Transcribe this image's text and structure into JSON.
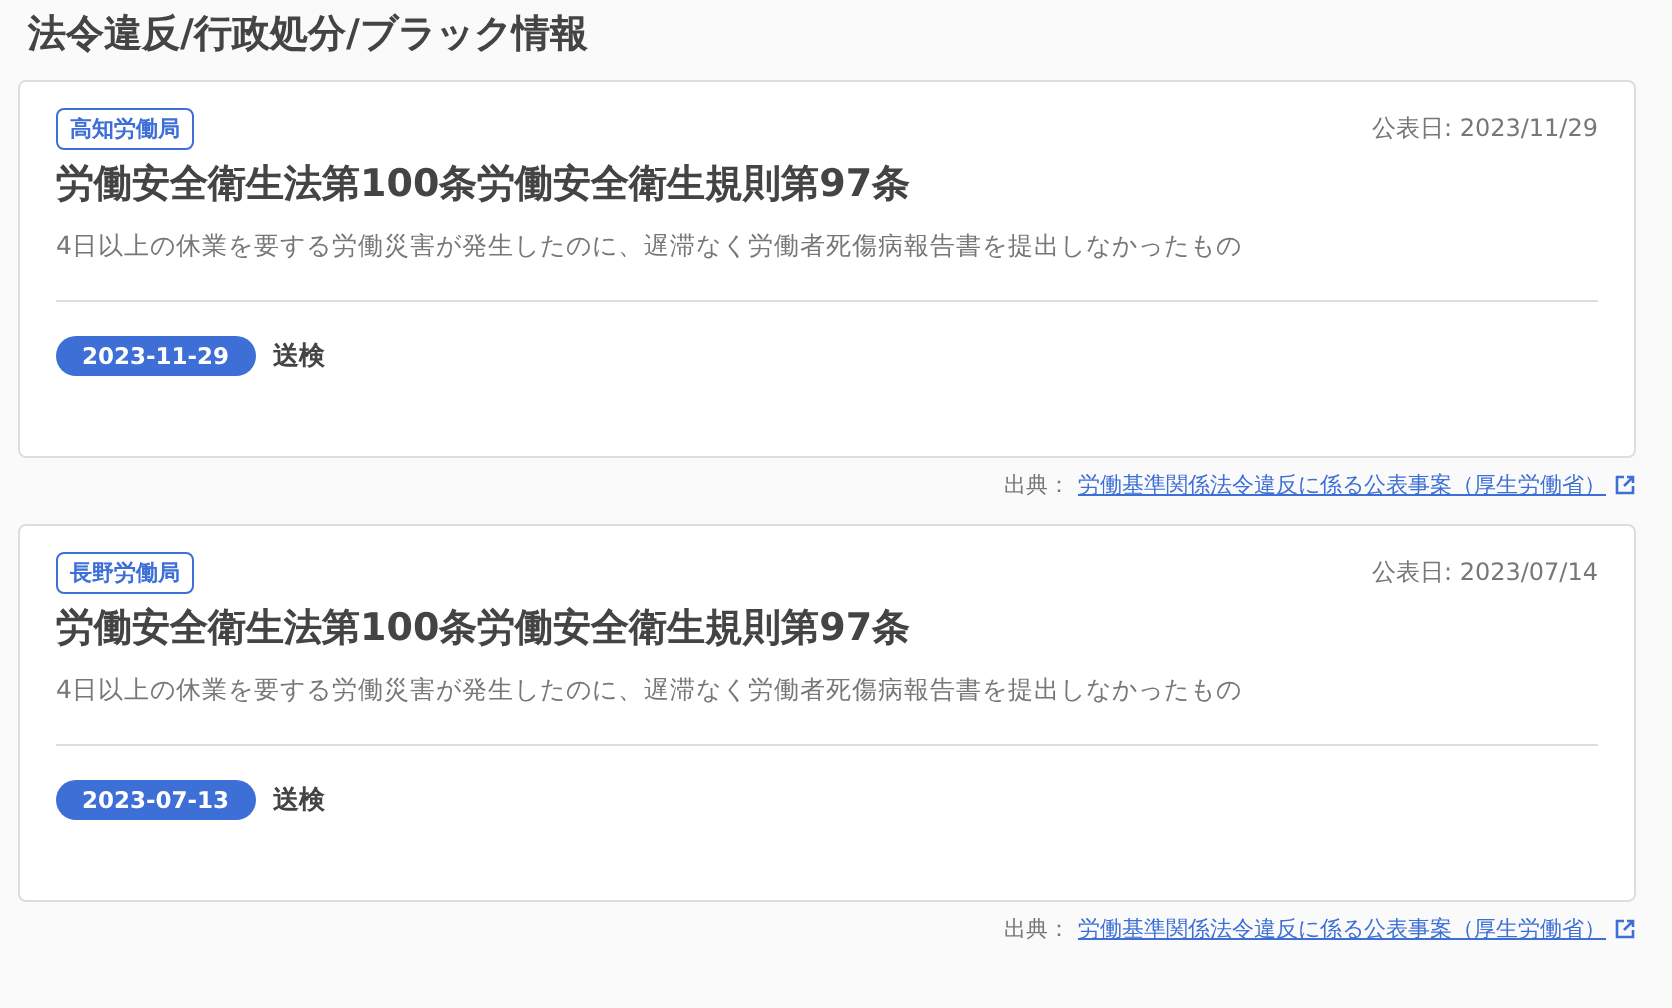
{
  "heading": "法令違反/行政処分/ブラック情報",
  "cases": [
    {
      "office": "高知労働局",
      "published": "公表日: 2023/11/29",
      "law": "労働安全衛生法第100条労働安全衛生規則第97条",
      "summary": "4日以上の休業を要する労働災害が発生したのに、遅滞なく労働者死傷病報告書を提出しなかったもの",
      "date": "2023-11-29",
      "action": "送検",
      "source_label": "出典：",
      "source_link": "労働基準関係法令違反に係る公表事案（厚生労働省）"
    },
    {
      "office": "長野労働局",
      "published": "公表日: 2023/07/14",
      "law": "労働安全衛生法第100条労働安全衛生規則第97条",
      "summary": "4日以上の休業を要する労働災害が発生したのに、遅滞なく労働者死傷病報告書を提出しなかったもの",
      "date": "2023-07-13",
      "action": "送検",
      "source_label": "出典：",
      "source_link": "労働基準関係法令違反に係る公表事案（厚生労働省）"
    }
  ]
}
